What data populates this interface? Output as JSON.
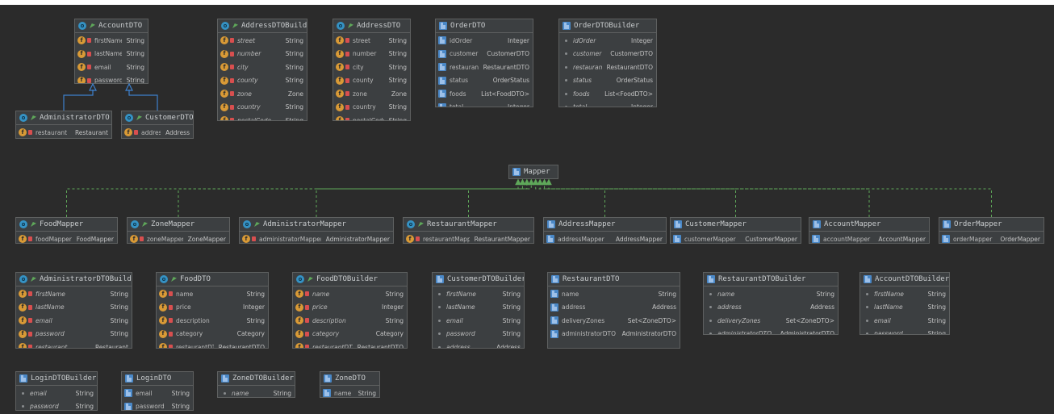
{
  "colors": {
    "background": "#2b2b2b",
    "node_fill": "#3c3f41",
    "node_border": "#5e6060",
    "inheritance_edge": "#3d80cc",
    "dependency_edge": "#5fa85a"
  },
  "diagram": {
    "nodes": [
      {
        "id": "AccountDTO",
        "title": "AccountDTO",
        "icon": "class-icon",
        "fields": [
          {
            "name": "firstName",
            "type": "String",
            "icon": "field-icon",
            "private": true
          },
          {
            "name": "lastName",
            "type": "String",
            "icon": "field-icon",
            "private": true
          },
          {
            "name": "email",
            "type": "String",
            "icon": "field-icon",
            "private": true
          },
          {
            "name": "password",
            "type": "String",
            "icon": "field-icon",
            "private": true
          }
        ]
      },
      {
        "id": "AddressDTOBuilder",
        "title": "AddressDTOBuilder",
        "icon": "class-icon",
        "fields": [
          {
            "name": "street",
            "type": "String",
            "icon": "field-icon",
            "private": true,
            "italic": true
          },
          {
            "name": "number",
            "type": "String",
            "icon": "field-icon",
            "private": true,
            "italic": true
          },
          {
            "name": "city",
            "type": "String",
            "icon": "field-icon",
            "private": true,
            "italic": true
          },
          {
            "name": "county",
            "type": "String",
            "icon": "field-icon",
            "private": true,
            "italic": true
          },
          {
            "name": "zone",
            "type": "Zone",
            "icon": "field-icon",
            "private": true,
            "italic": true
          },
          {
            "name": "country",
            "type": "String",
            "icon": "field-icon",
            "private": true,
            "italic": true
          },
          {
            "name": "postalCode",
            "type": "String",
            "icon": "field-icon",
            "private": true,
            "italic": true
          }
        ]
      },
      {
        "id": "AddressDTO",
        "title": "AddressDTO",
        "icon": "class-icon",
        "fields": [
          {
            "name": "street",
            "type": "String",
            "icon": "field-icon",
            "private": true
          },
          {
            "name": "number",
            "type": "String",
            "icon": "field-icon",
            "private": true
          },
          {
            "name": "city",
            "type": "String",
            "icon": "field-icon",
            "private": true
          },
          {
            "name": "county",
            "type": "String",
            "icon": "field-icon",
            "private": true
          },
          {
            "name": "zone",
            "type": "Zone",
            "icon": "field-icon",
            "private": true
          },
          {
            "name": "country",
            "type": "String",
            "icon": "field-icon",
            "private": true
          },
          {
            "name": "postalCode",
            "type": "String",
            "icon": "field-icon",
            "private": true
          }
        ]
      },
      {
        "id": "OrderDTO",
        "title": "OrderDTO",
        "icon": "lombok-icon",
        "fields": [
          {
            "name": "idOrder",
            "type": "Integer",
            "icon": "lombok-icon"
          },
          {
            "name": "customer",
            "type": "CustomerDTO",
            "icon": "lombok-icon"
          },
          {
            "name": "restaurant",
            "type": "RestaurantDTO",
            "icon": "lombok-icon"
          },
          {
            "name": "status",
            "type": "OrderStatus",
            "icon": "lombok-icon"
          },
          {
            "name": "foods",
            "type": "List<FoodDTO>",
            "icon": "lombok-icon"
          },
          {
            "name": "total",
            "type": "Integer",
            "icon": "lombok-icon"
          }
        ]
      },
      {
        "id": "OrderDTOBuilder",
        "title": "OrderDTOBuilder",
        "icon": "lombok-icon",
        "fields": [
          {
            "name": "idOrder",
            "type": "Integer",
            "icon": "dot-icon",
            "italic": true
          },
          {
            "name": "customer",
            "type": "CustomerDTO",
            "icon": "dot-icon",
            "italic": true
          },
          {
            "name": "restaurant",
            "type": "RestaurantDTO",
            "icon": "dot-icon",
            "italic": true
          },
          {
            "name": "status",
            "type": "OrderStatus",
            "icon": "dot-icon",
            "italic": true
          },
          {
            "name": "foods",
            "type": "List<FoodDTO>",
            "icon": "dot-icon",
            "italic": true
          },
          {
            "name": "total",
            "type": "Integer",
            "icon": "dot-icon",
            "italic": true
          }
        ]
      },
      {
        "id": "AdministratorDTO",
        "title": "AdministratorDTO",
        "icon": "class-icon",
        "fields": [
          {
            "name": "restaurant",
            "type": "Restaurant",
            "icon": "field-icon",
            "private": true
          }
        ]
      },
      {
        "id": "CustomerDTO",
        "title": "CustomerDTO",
        "icon": "class-icon",
        "fields": [
          {
            "name": "address",
            "type": "Address",
            "icon": "field-icon",
            "private": true
          }
        ]
      },
      {
        "id": "Mapper",
        "title": "Mapper",
        "icon": "lombok-icon",
        "fields": []
      },
      {
        "id": "FoodMapper",
        "title": "FoodMapper",
        "icon": "class-icon",
        "fields": [
          {
            "name": "foodMapper",
            "type": "FoodMapper",
            "icon": "field-icon",
            "private": true
          }
        ]
      },
      {
        "id": "ZoneMapper",
        "title": "ZoneMapper",
        "icon": "class-icon",
        "fields": [
          {
            "name": "zoneMapper",
            "type": "ZoneMapper",
            "icon": "field-icon",
            "private": true
          }
        ]
      },
      {
        "id": "AdministratorMapper",
        "title": "AdministratorMapper",
        "icon": "class-icon",
        "fields": [
          {
            "name": "administratorMapper",
            "type": "AdministratorMapper",
            "icon": "field-icon",
            "private": true
          }
        ]
      },
      {
        "id": "RestaurantMapper",
        "title": "RestaurantMapper",
        "icon": "class-icon",
        "fields": [
          {
            "name": "restaurantMapper",
            "type": "RestaurantMapper",
            "icon": "field-icon",
            "private": true
          }
        ]
      },
      {
        "id": "AddressMapper",
        "title": "AddressMapper",
        "icon": "lombok-icon",
        "fields": [
          {
            "name": "addressMapper",
            "type": "AddressMapper",
            "icon": "lombok-icon"
          }
        ]
      },
      {
        "id": "CustomerMapper",
        "title": "CustomerMapper",
        "icon": "lombok-icon",
        "fields": [
          {
            "name": "customerMapper",
            "type": "CustomerMapper",
            "icon": "lombok-icon"
          }
        ]
      },
      {
        "id": "AccountMapper",
        "title": "AccountMapper",
        "icon": "lombok-icon",
        "fields": [
          {
            "name": "accountMapper",
            "type": "AccountMapper",
            "icon": "lombok-icon"
          }
        ]
      },
      {
        "id": "OrderMapper",
        "title": "OrderMapper",
        "icon": "lombok-icon",
        "fields": [
          {
            "name": "orderMapper",
            "type": "OrderMapper",
            "icon": "lombok-icon"
          }
        ]
      },
      {
        "id": "AdministratorDTOBuilder",
        "title": "AdministratorDTOBuilder",
        "icon": "class-icon",
        "fields": [
          {
            "name": "firstName",
            "type": "String",
            "icon": "field-icon",
            "private": true,
            "italic": true
          },
          {
            "name": "lastName",
            "type": "String",
            "icon": "field-icon",
            "private": true,
            "italic": true
          },
          {
            "name": "email",
            "type": "String",
            "icon": "field-icon",
            "private": true,
            "italic": true
          },
          {
            "name": "password",
            "type": "String",
            "icon": "field-icon",
            "private": true,
            "italic": true
          },
          {
            "name": "restaurant",
            "type": "Restaurant",
            "icon": "field-icon",
            "private": true,
            "italic": true
          }
        ]
      },
      {
        "id": "FoodDTO",
        "title": "FoodDTO",
        "icon": "class-icon",
        "fields": [
          {
            "name": "name",
            "type": "String",
            "icon": "field-icon",
            "private": true
          },
          {
            "name": "price",
            "type": "Integer",
            "icon": "field-icon",
            "private": true
          },
          {
            "name": "description",
            "type": "String",
            "icon": "field-icon",
            "private": true
          },
          {
            "name": "category",
            "type": "Category",
            "icon": "field-icon",
            "private": true
          },
          {
            "name": "restaurantDTO",
            "type": "RestaurantDTO",
            "icon": "field-icon",
            "private": true
          }
        ]
      },
      {
        "id": "FoodDTOBuilder",
        "title": "FoodDTOBuilder",
        "icon": "class-icon",
        "fields": [
          {
            "name": "name",
            "type": "String",
            "icon": "field-icon",
            "private": true,
            "italic": true
          },
          {
            "name": "price",
            "type": "Integer",
            "icon": "field-icon",
            "private": true,
            "italic": true
          },
          {
            "name": "description",
            "type": "String",
            "icon": "field-icon",
            "private": true,
            "italic": true
          },
          {
            "name": "category",
            "type": "Category",
            "icon": "field-icon",
            "private": true,
            "italic": true
          },
          {
            "name": "restaurantDTO",
            "type": "RestaurantDTO",
            "icon": "field-icon",
            "private": true,
            "italic": true
          }
        ]
      },
      {
        "id": "CustomerDTOBuilder",
        "title": "CustomerDTOBuilder",
        "icon": "lombok-icon",
        "fields": [
          {
            "name": "firstName",
            "type": "String",
            "icon": "dot-icon",
            "italic": true
          },
          {
            "name": "lastName",
            "type": "String",
            "icon": "dot-icon",
            "italic": true
          },
          {
            "name": "email",
            "type": "String",
            "icon": "dot-icon",
            "italic": true
          },
          {
            "name": "password",
            "type": "String",
            "icon": "dot-icon",
            "italic": true
          },
          {
            "name": "address",
            "type": "Address",
            "icon": "dot-icon",
            "italic": true
          }
        ]
      },
      {
        "id": "RestaurantDTO",
        "title": "RestaurantDTO",
        "icon": "lombok-icon",
        "fields": [
          {
            "name": "name",
            "type": "String",
            "icon": "lombok-icon"
          },
          {
            "name": "address",
            "type": "Address",
            "icon": "lombok-icon"
          },
          {
            "name": "deliveryZones",
            "type": "Set<ZoneDTO>",
            "icon": "lombok-icon"
          },
          {
            "name": "administratorDTO",
            "type": "AdministratorDTO",
            "icon": "lombok-icon"
          }
        ]
      },
      {
        "id": "RestaurantDTOBuilder",
        "title": "RestaurantDTOBuilder",
        "icon": "lombok-icon",
        "fields": [
          {
            "name": "name",
            "type": "String",
            "icon": "dot-icon",
            "italic": true
          },
          {
            "name": "address",
            "type": "Address",
            "icon": "dot-icon",
            "italic": true
          },
          {
            "name": "deliveryZones",
            "type": "Set<ZoneDTO>",
            "icon": "dot-icon",
            "italic": true
          },
          {
            "name": "administratorDTO",
            "type": "AdministratorDTO",
            "icon": "dot-icon",
            "italic": true
          }
        ]
      },
      {
        "id": "AccountDTOBuilder",
        "title": "AccountDTOBuilder",
        "icon": "lombok-icon",
        "fields": [
          {
            "name": "firstName",
            "type": "String",
            "icon": "dot-icon",
            "italic": true
          },
          {
            "name": "lastName",
            "type": "String",
            "icon": "dot-icon",
            "italic": true
          },
          {
            "name": "email",
            "type": "String",
            "icon": "dot-icon",
            "italic": true
          },
          {
            "name": "password",
            "type": "String",
            "icon": "dot-icon",
            "italic": true
          }
        ]
      },
      {
        "id": "LoginDTOBuilder",
        "title": "LoginDTOBuilder",
        "icon": "lombok-icon",
        "fields": [
          {
            "name": "email",
            "type": "String",
            "icon": "dot-icon",
            "italic": true
          },
          {
            "name": "password",
            "type": "String",
            "icon": "dot-icon",
            "italic": true
          }
        ]
      },
      {
        "id": "LoginDTO",
        "title": "LoginDTO",
        "icon": "lombok-icon",
        "fields": [
          {
            "name": "email",
            "type": "String",
            "icon": "lombok-icon"
          },
          {
            "name": "password",
            "type": "String",
            "icon": "lombok-icon"
          }
        ]
      },
      {
        "id": "ZoneDTOBuilder",
        "title": "ZoneDTOBuilder",
        "icon": "lombok-icon",
        "fields": [
          {
            "name": "name",
            "type": "String",
            "icon": "dot-icon",
            "italic": true
          }
        ]
      },
      {
        "id": "ZoneDTO",
        "title": "ZoneDTO",
        "icon": "lombok-icon",
        "fields": [
          {
            "name": "name",
            "type": "String",
            "icon": "lombok-icon"
          }
        ]
      }
    ],
    "edges": [
      {
        "from": "AdministratorDTO",
        "to": "AccountDTO",
        "kind": "inheritance"
      },
      {
        "from": "CustomerDTO",
        "to": "AccountDTO",
        "kind": "inheritance"
      },
      {
        "from": "FoodMapper",
        "to": "Mapper",
        "kind": "dependency"
      },
      {
        "from": "ZoneMapper",
        "to": "Mapper",
        "kind": "dependency"
      },
      {
        "from": "AdministratorMapper",
        "to": "Mapper",
        "kind": "dependency"
      },
      {
        "from": "RestaurantMapper",
        "to": "Mapper",
        "kind": "dependency"
      },
      {
        "from": "AddressMapper",
        "to": "Mapper",
        "kind": "dependency"
      },
      {
        "from": "CustomerMapper",
        "to": "Mapper",
        "kind": "dependency"
      },
      {
        "from": "AccountMapper",
        "to": "Mapper",
        "kind": "dependency"
      },
      {
        "from": "OrderMapper",
        "to": "Mapper",
        "kind": "dependency"
      }
    ]
  }
}
